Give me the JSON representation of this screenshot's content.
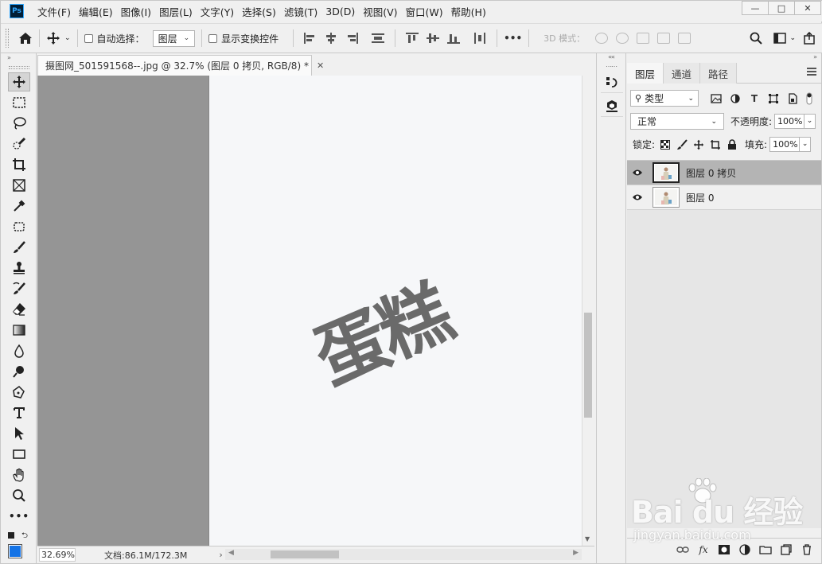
{
  "app": {
    "logo": "Ps"
  },
  "menu": [
    "文件(F)",
    "编辑(E)",
    "图像(I)",
    "图层(L)",
    "文字(Y)",
    "选择(S)",
    "滤镜(T)",
    "3D(D)",
    "视图(V)",
    "窗口(W)",
    "帮助(H)"
  ],
  "window_controls": {
    "minimize": "—",
    "maximize": "□",
    "close": "✕"
  },
  "options": {
    "auto_select_label": "自动选择：",
    "auto_select_target": "图层",
    "show_transform_label": "显示变换控件",
    "more": "•••",
    "mode3d_label": "3D 模式："
  },
  "document": {
    "tab_title": "摄图网_501591568--.jpg @ 32.7% (图层 0 拷贝, RGB/8) *",
    "tab_close": "✕",
    "canvas_text": "蛋糕",
    "zoom": "32.69%",
    "doc_size": "文档:86.1M/172.3M",
    "status_arrow": "›"
  },
  "panel": {
    "tabs": [
      "图层",
      "通道",
      "路径"
    ],
    "filter_kind": "类型",
    "blend_mode": "正常",
    "opacity_label": "不透明度:",
    "opacity_value": "100%",
    "lock_label": "锁定:",
    "fill_label": "填充:",
    "fill_value": "100%",
    "layers": [
      {
        "name": "图层 0 拷贝",
        "selected": true,
        "visible": true
      },
      {
        "name": "图层 0",
        "selected": false,
        "visible": true
      }
    ],
    "footer_icons": [
      "link-icon",
      "fx-icon",
      "mask-icon",
      "adjustment-icon",
      "folder-icon",
      "new-layer-icon",
      "trash-icon"
    ],
    "fx_label": "fx"
  },
  "watermark": {
    "main": "Bai du 经验",
    "sub": "jingyan.baidu.com"
  },
  "colors": {
    "foreground": "#1473e6",
    "selected_layer": "#b4b4b4",
    "canvas_bg": "#959595",
    "text_gray": "#6a6a6a"
  }
}
